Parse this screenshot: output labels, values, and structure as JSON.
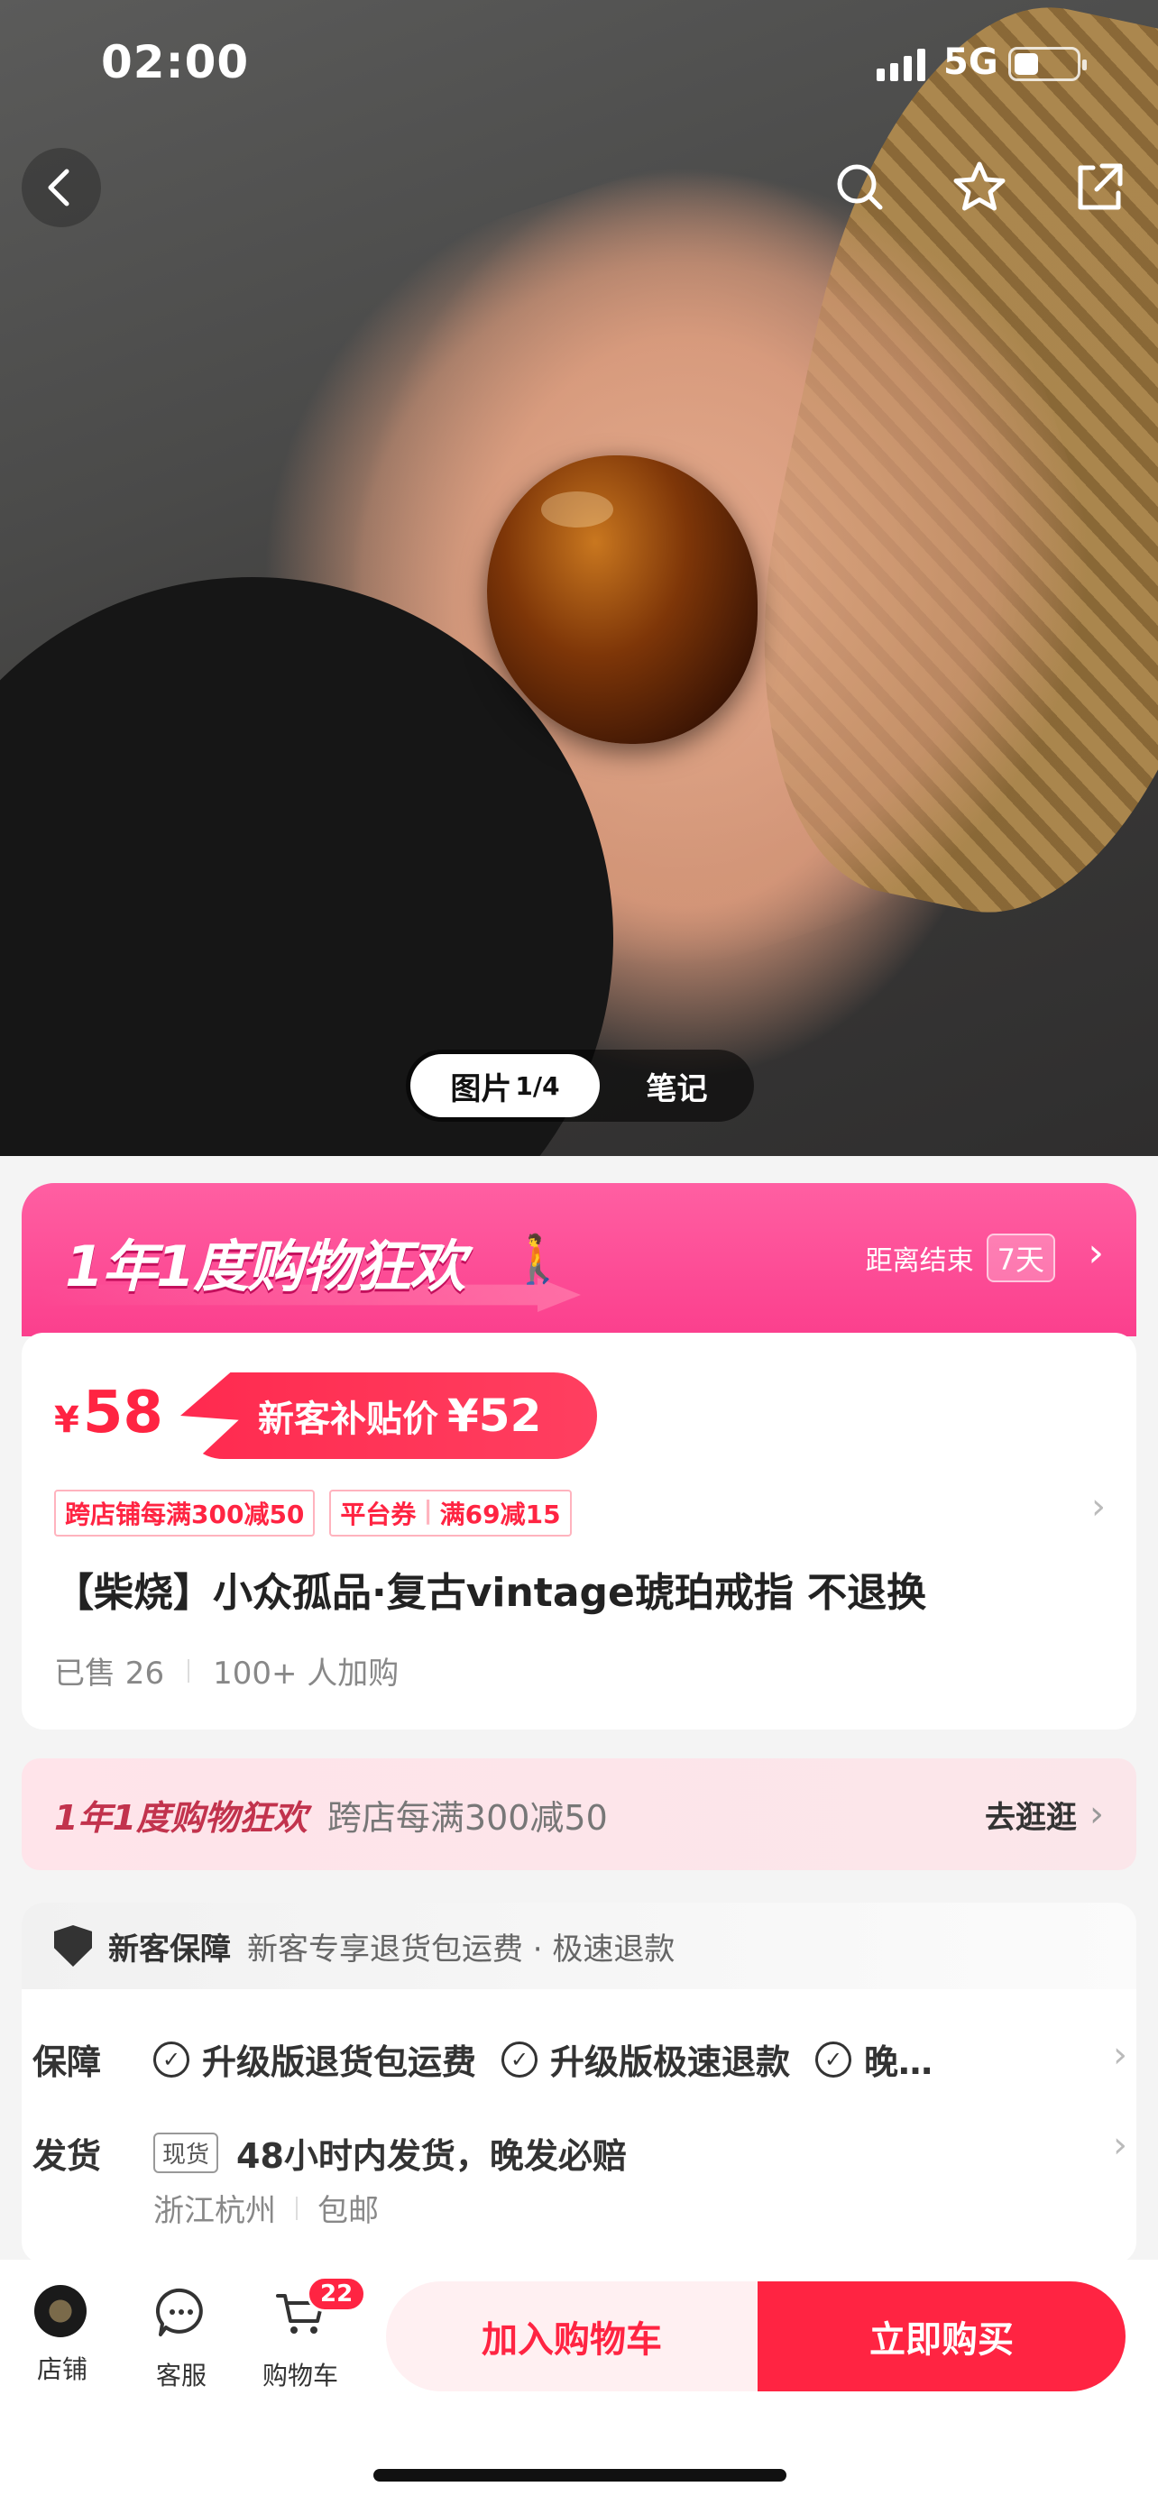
{
  "status_bar": {
    "time": "02:00",
    "network": "5G"
  },
  "gallery": {
    "tabs": [
      {
        "label": "图片",
        "counter": "1/4"
      },
      {
        "label": "笔记"
      }
    ]
  },
  "promo": {
    "title": "1年1度购物狂欢",
    "countdown_label": "距离结束",
    "countdown_value": "7天"
  },
  "product": {
    "currency": "¥",
    "price": "58",
    "subsidy_label": "新客补贴价",
    "subsidy_price": "¥52",
    "coupons": [
      {
        "a": "跨店铺每满300减50"
      },
      {
        "a": "平台券",
        "b": "满69减15"
      }
    ],
    "title": "【柴烧】小众孤品·复古vintage琥珀戒指 不退换",
    "sold": "已售 26",
    "carted": "100+ 人加购"
  },
  "campaign_strip": {
    "logo": "1年1度购物狂欢",
    "text": "跨店每满300减50",
    "action": "去逛逛"
  },
  "guarantee": {
    "header_label": "新客保障",
    "header_sub": "新客专享退货包运费 · 极速退款",
    "rows": [
      {
        "key": "保障",
        "items": [
          "升级版退货包运费",
          "升级版极速退款",
          "晚…"
        ]
      },
      {
        "key": "发货",
        "tag": "现货",
        "text": "48小时内发货，晚发必赔"
      }
    ],
    "location": "浙江杭州",
    "shipping": "包邮"
  },
  "bottom_bar": {
    "store": "店铺",
    "service": "客服",
    "cart": "购物车",
    "cart_count": "22",
    "add_to_cart": "加入购物车",
    "buy_now": "立即购买"
  },
  "colors": {
    "accent": "#ff2442",
    "promo_pink": "#fb3f8d"
  }
}
